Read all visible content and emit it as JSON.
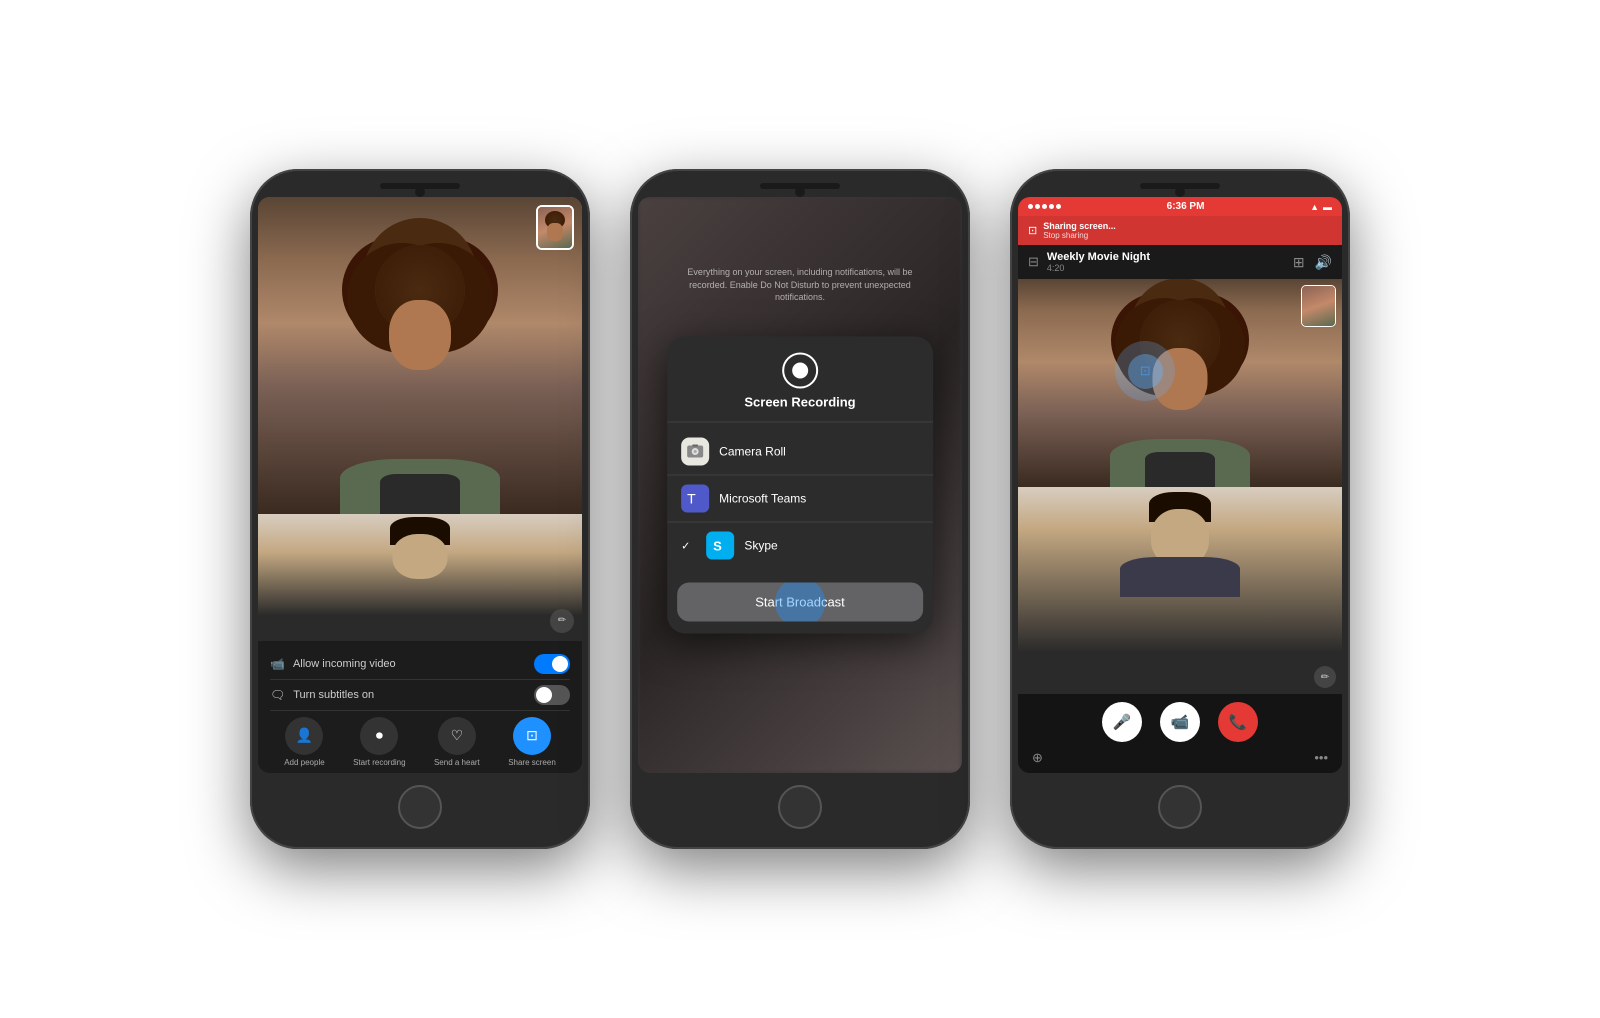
{
  "page": {
    "bg_color": "#ffffff"
  },
  "phone1": {
    "controls": {
      "incoming_video_label": "Allow incoming video",
      "subtitles_label": "Turn subtitles on"
    },
    "actions": {
      "add_people": "Add people",
      "start_recording": "Start recording",
      "send_heart": "Send a heart",
      "share_screen": "Share screen"
    }
  },
  "phone2": {
    "info_text": "Everything on your screen, including notifications, will be recorded. Enable Do Not Disturb to prevent unexpected notifications.",
    "popup": {
      "title": "Screen Recording",
      "items": [
        {
          "label": "Camera Roll",
          "icon_type": "camera-roll"
        },
        {
          "label": "Microsoft Teams",
          "icon_type": "teams"
        },
        {
          "label": "Skype",
          "icon_type": "skype",
          "selected": true
        }
      ],
      "broadcast_btn": "Start Broadcast"
    }
  },
  "phone3": {
    "status_bar": {
      "time": "6:36 PM"
    },
    "sharing_bar": {
      "label": "Sharing screen...",
      "sub_label": "Stop sharing"
    },
    "call": {
      "name": "Weekly Movie Night",
      "time": "4:20"
    }
  }
}
